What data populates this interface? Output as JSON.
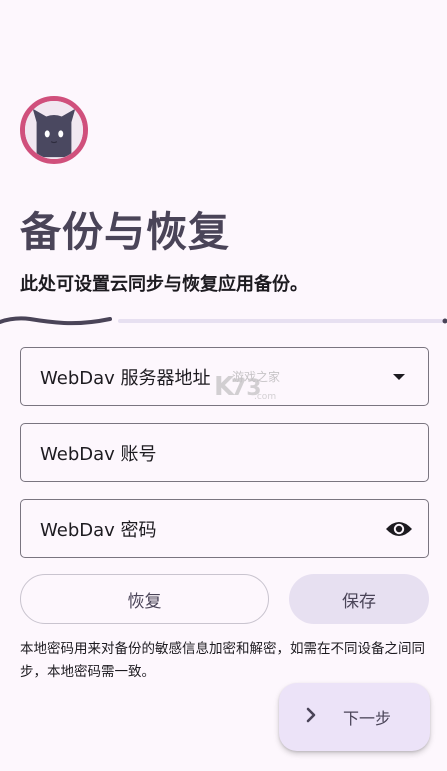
{
  "header": {
    "title": "备份与恢复",
    "subtitle": "此处可设置云同步与恢复应用备份。"
  },
  "form": {
    "server_placeholder": "WebDav 服务器地址",
    "account_placeholder": "WebDav 账号",
    "password_placeholder": "WebDav 密码"
  },
  "actions": {
    "restore_label": "恢复",
    "save_label": "保存"
  },
  "note": "本地密码用来对备份的敏感信息加密和解密，如需在不同设备之间同步，本地密码需一致。",
  "fab": {
    "next_label": "下一步",
    "icon": "chevron-right-icon"
  },
  "watermark": {
    "text": "游戏之家"
  },
  "colors": {
    "background": "#fdf7fd",
    "title": "#4a4458",
    "avatar_ring": "#d0507c",
    "fab": "#ece3f8",
    "save_button": "#e7e0f1"
  }
}
